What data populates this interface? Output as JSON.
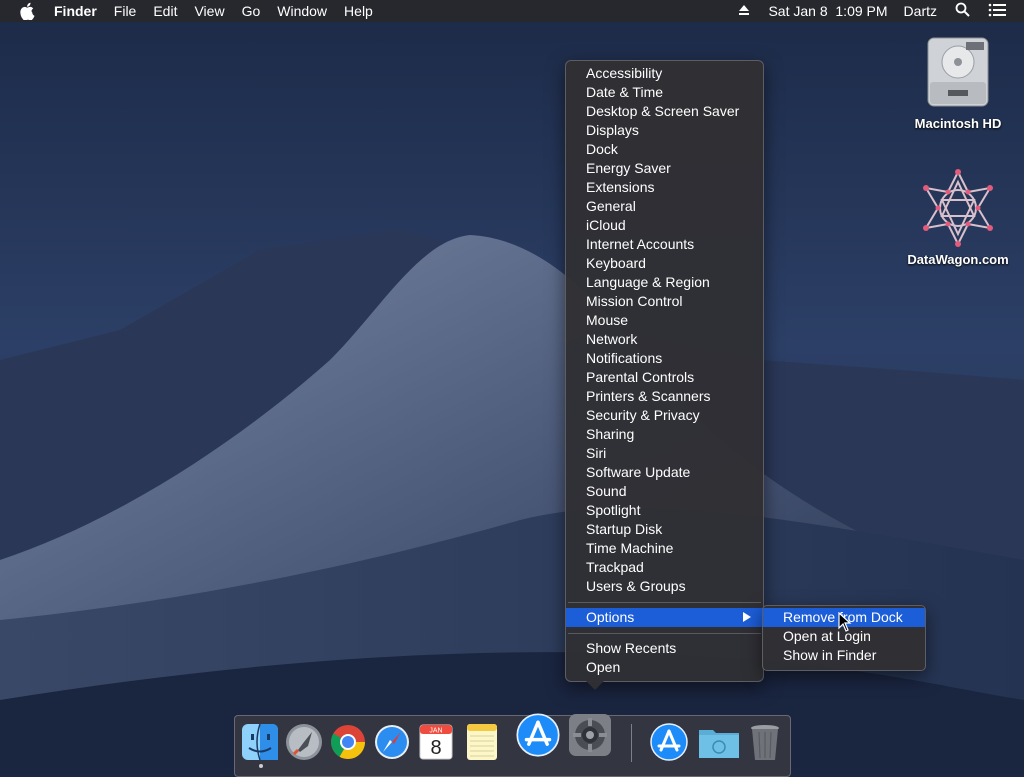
{
  "menubar": {
    "app_name": "Finder",
    "menus": [
      "File",
      "Edit",
      "View",
      "Go",
      "Window",
      "Help"
    ],
    "clock": "Sat Jan 8  1:09 PM",
    "user": "Dartz"
  },
  "desktop_icons": [
    {
      "label": "Macintosh HD",
      "icon": "hard-drive-icon"
    },
    {
      "label": "DataWagon.com",
      "icon": "network-volume-icon"
    }
  ],
  "context_menu": {
    "items": [
      "Accessibility",
      "Date & Time",
      "Desktop & Screen Saver",
      "Displays",
      "Dock",
      "Energy Saver",
      "Extensions",
      "General",
      "iCloud",
      "Internet Accounts",
      "Keyboard",
      "Language & Region",
      "Mission Control",
      "Mouse",
      "Network",
      "Notifications",
      "Parental Controls",
      "Printers & Scanners",
      "Security & Privacy",
      "Sharing",
      "Siri",
      "Software Update",
      "Sound",
      "Spotlight",
      "Startup Disk",
      "Time Machine",
      "Trackpad",
      "Users & Groups"
    ],
    "options_label": "Options",
    "show_recents_label": "Show Recents",
    "open_label": "Open"
  },
  "submenu": {
    "items": [
      "Remove from Dock",
      "Open at Login",
      "Show in Finder"
    ]
  },
  "dock": {
    "apps": [
      {
        "name": "Finder",
        "icon": "finder-icon"
      },
      {
        "name": "Launchpad",
        "icon": "launchpad-icon"
      },
      {
        "name": "Chrome",
        "icon": "chrome-icon"
      },
      {
        "name": "Safari",
        "icon": "safari-icon"
      },
      {
        "name": "Calendar",
        "icon": "calendar-icon",
        "month": "JAN",
        "day": "8"
      },
      {
        "name": "Notes",
        "icon": "notes-icon"
      },
      {
        "name": "App Store",
        "icon": "app-store-icon"
      },
      {
        "name": "System Preferences",
        "icon": "system-preferences-icon"
      },
      {
        "name": "Applications",
        "icon": "applications-folder-icon"
      },
      {
        "name": "Downloads",
        "icon": "downloads-folder-icon"
      },
      {
        "name": "Trash",
        "icon": "trash-icon"
      }
    ]
  },
  "colors": {
    "menu_highlight": "#1c5dd8",
    "menu_background": "#303034"
  }
}
